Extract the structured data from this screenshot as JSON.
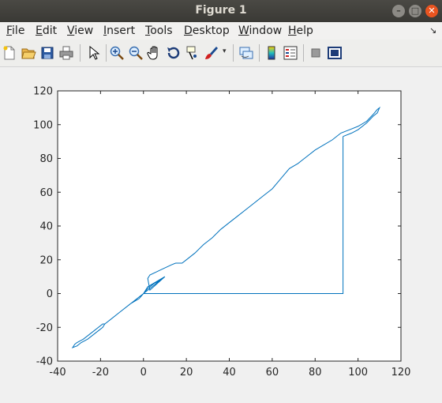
{
  "window": {
    "title": "Figure 1"
  },
  "menu": [
    {
      "label": "File",
      "mn": "F",
      "rest": "ile"
    },
    {
      "label": "Edit",
      "mn": "E",
      "rest": "dit"
    },
    {
      "label": "View",
      "mn": "V",
      "rest": "iew"
    },
    {
      "label": "Insert",
      "mn": "I",
      "rest": "nsert"
    },
    {
      "label": "Tools",
      "mn": "T",
      "rest": "ools"
    },
    {
      "label": "Desktop",
      "mn": "D",
      "rest": "esktop"
    },
    {
      "label": "Window",
      "mn": "W",
      "rest": "indow"
    },
    {
      "label": "Help",
      "mn": "H",
      "rest": "elp"
    }
  ],
  "toolbar": {
    "icons": [
      "new-figure-icon",
      "open-file-icon",
      "save-icon",
      "print-icon",
      "pointer-icon",
      "zoom-in-icon",
      "zoom-out-icon",
      "pan-icon",
      "rotate-3d-icon",
      "data-cursor-icon",
      "brush-icon",
      "link-plot-icon",
      "colorbar-icon",
      "legend-icon",
      "hide-plot-tools-icon",
      "show-plot-tools-icon"
    ]
  },
  "chart_data": {
    "type": "line",
    "title": "",
    "xlabel": "",
    "ylabel": "",
    "xlim": [
      -40,
      120
    ],
    "ylim": [
      -40,
      120
    ],
    "xticks": [
      -40,
      -20,
      0,
      20,
      40,
      60,
      80,
      100,
      120
    ],
    "yticks": [
      -40,
      -20,
      0,
      20,
      40,
      60,
      80,
      100,
      120
    ],
    "xtick_labels": [
      "-40",
      "-20",
      "0",
      "20",
      "40",
      "60",
      "80",
      "100",
      "120"
    ],
    "ytick_labels": [
      "-40",
      "-20",
      "0",
      "20",
      "40",
      "60",
      "80",
      "100",
      "120"
    ],
    "grid": false,
    "color": "#0072bd",
    "series": [
      {
        "x": [
          93,
          93,
          0,
          10,
          2,
          0,
          -2,
          -6,
          -12,
          -18,
          -19,
          -24,
          -28,
          -31,
          -32,
          -33,
          -33,
          -31,
          -29,
          -26,
          -22,
          -19,
          -18,
          -15,
          -11,
          -8,
          -5,
          -2,
          0,
          2,
          5,
          8,
          10,
          3,
          2,
          3,
          8,
          13,
          15,
          16,
          18,
          20,
          24,
          28,
          32,
          36,
          40,
          44,
          48,
          52,
          56,
          60,
          64,
          68,
          72,
          76,
          80,
          84,
          88,
          92,
          96,
          100,
          104,
          107,
          109,
          110,
          109,
          107,
          104,
          100,
          97,
          93
        ],
        "y": [
          93,
          0,
          0,
          10,
          4,
          0,
          -3,
          -6,
          -12,
          -18,
          -18,
          -23,
          -27,
          -29,
          -30,
          -32,
          -32,
          -31,
          -29,
          -27,
          -23,
          -20,
          -18,
          -15,
          -11,
          -8,
          -5,
          -2,
          0,
          3,
          6,
          8,
          10,
          2,
          9,
          11,
          14,
          17,
          18,
          18,
          18,
          20,
          24,
          29,
          33,
          38,
          42,
          46,
          50,
          54,
          58,
          62,
          68,
          74,
          77,
          81,
          85,
          88,
          91,
          95,
          97,
          99,
          102,
          106,
          109,
          110,
          107,
          105,
          101,
          97,
          95,
          93
        ]
      }
    ]
  }
}
